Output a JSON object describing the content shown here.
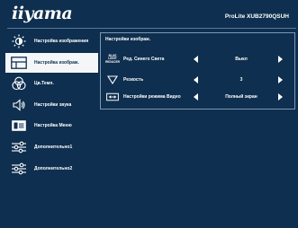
{
  "header": {
    "brand": "iiyama",
    "model": "ProLite XUB2790QSUH"
  },
  "sidebar": {
    "items": [
      {
        "label": "Настройка изображения",
        "icon": "brightness-icon",
        "active": false
      },
      {
        "label": "Настройка изображ.",
        "icon": "picture-adjust-icon",
        "active": true
      },
      {
        "label": "Цв.Темп.",
        "icon": "color-temp-icon",
        "active": false
      },
      {
        "label": "Настройки звука",
        "icon": "speaker-icon",
        "active": false
      },
      {
        "label": "Настройка Меню",
        "icon": "menu-icon",
        "active": false
      },
      {
        "label": "Дополнительно1",
        "icon": "sliders-icon",
        "active": false
      },
      {
        "label": "Дополнительно2",
        "icon": "sliders-icon",
        "active": false
      }
    ]
  },
  "panel": {
    "title": "Настройки изображ.",
    "rows": [
      {
        "label": "Ред. Синего Света",
        "value": "Выкл",
        "icon": "blue-light-icon",
        "icon_text": [
          "BLUE",
          "LIGHT",
          "REDUCER"
        ]
      },
      {
        "label": "Резкость",
        "value": "3",
        "icon": "sharpness-icon"
      },
      {
        "label": "Настройки режима Видео",
        "value": "Полный экран",
        "icon": "video-mode-icon"
      }
    ]
  },
  "colors": {
    "background": "#0e2f4f",
    "active_bg": "#f4f6f8",
    "border": "#7d98b4"
  }
}
